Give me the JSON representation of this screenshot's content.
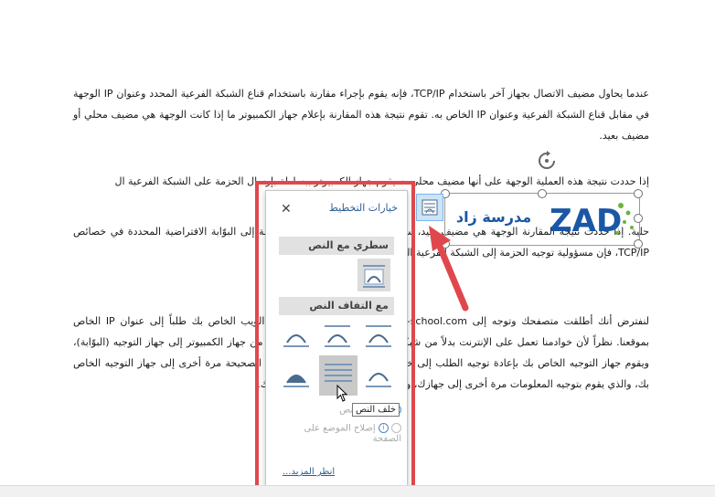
{
  "document": {
    "paragraph1": "عندما يحاول مضيف الاتصال بجهاز آخر باستخدام TCP/IP، فإنه يقوم بإجراء مقارنة باستخدام قناع الشبكة الفرعية المحدد وعنوان IP الوجهة في مقابل قناع الشبكة الفرعية وعنوان IP الخاص به. تقوم نتيجة هذه المقارنة بإعلام جهاز الكمبيوتر ما إذا كانت الوجهة هي مضيف محلي أو مضيف بعيد.",
    "paragraph2": "إذا حددت نتيجة هذه العملية الوجهة على أنها مضيف محلي، سيقوم جهاز الكمبيوتر ببساطة بإرسال الحزمة على الشبكة الفرعية ال",
    "paragraph3": "حلية. إذا حددت نتيجة المقارنة الوجهة هي مضيف بعيد، سيقوم جهاز الكمبيوتر بتوجيه الحزمة إلى البوّابة الافتراضية المحددة في خصائص TCP/IP، فإن مسؤولية توجيه الحزمة إلى الشبكة الفرعية الصحيحة تقع على الموجه.",
    "paragraph4": "لنفترض أنك أطلقت متصفحك وتوجه إلى www.example-school.com. يرسل متصفح الويب الخاص بك طلباً إلى عنوان IP الخاص بموقعنا. نظراً لأن خوادمنا تعمل على الإنترنت بدلاً من شبكتك المحلية، فيتم إرسال الطلبات من جهاز الكمبيوتر إلى جهاز التوجيه (البوّابة)، ويقوم جهاز التوجيه الخاص بك بإعادة توجيه الطلب إلى خادمنا، ثم يرسل الخادم المعلومات الصحيحة مرة أخرى إلى جهاز التوجيه الخاص بك، والذي يقوم بتوجيه المعلومات مرة أخرى إلى جهازك، وترى موقعنا في المتصفح الخاص بك."
  },
  "logo": {
    "text": "مدرسة زاد",
    "mark": "ZAD",
    "brand_color": "#1a57a6",
    "accent_color": "#6cb33f"
  },
  "layout_options": {
    "title": "خيارات التخطيط",
    "close_icon": "close-icon",
    "section_inline": "سطري مع النص",
    "section_wrap": "مع التفاف النص",
    "tooltip": "خلف النص",
    "option_move": "نقل مع النص",
    "option_fix": "إصلاح الموضع على الصفحة",
    "see_more": "انظر المزيد...",
    "selected_option": "behind-text"
  },
  "colors": {
    "highlight_frame": "#e0474c",
    "arrow": "#e0474c",
    "link": "#2c5d93"
  }
}
